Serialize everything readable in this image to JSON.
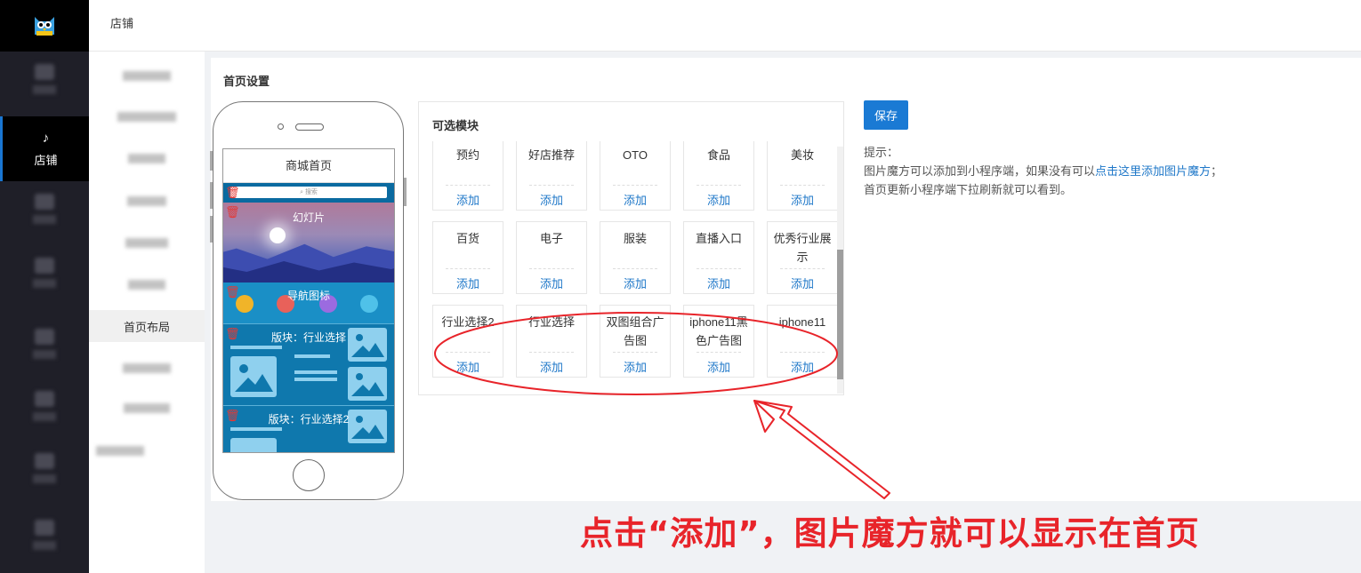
{
  "topbar": {
    "title": "店铺"
  },
  "rail": {
    "active_label": "店铺"
  },
  "submenu": {
    "active_label": "首页布局"
  },
  "page": {
    "title": "首页设置"
  },
  "phone": {
    "screen_title": "商城首页",
    "search_placeholder": "搜索",
    "slide_label": "幻灯片",
    "nav_label": "导航图标",
    "block1_label": "版块：行业选择",
    "block2_label": "版块：行业选择2"
  },
  "modules": {
    "title": "可选模块",
    "add_label": "添加",
    "items": [
      {
        "name": "预约"
      },
      {
        "name": "好店推荐"
      },
      {
        "name": "OTO"
      },
      {
        "name": "食品"
      },
      {
        "name": "美妆"
      },
      {
        "name": "百货"
      },
      {
        "name": "电子"
      },
      {
        "name": "服装"
      },
      {
        "name": "直播入口"
      },
      {
        "name": "优秀行业展示"
      },
      {
        "name": "行业选择2"
      },
      {
        "name": "行业选择"
      },
      {
        "name": "双图组合广告图"
      },
      {
        "name": "iphone11黑色广告图"
      },
      {
        "name": "iphone11"
      }
    ]
  },
  "actions": {
    "save_label": "保存"
  },
  "tips": {
    "heading": "提示：",
    "line1_prefix": "图片魔方可以添加到小程序端，如果没有可以",
    "line1_link": "点击这里添加图片魔方",
    "line1_suffix": "；",
    "line2": "首页更新小程序端下拉刷新就可以看到。"
  },
  "annotation": {
    "text": "点击“添加”，图片魔方就可以显示在首页"
  },
  "colors": {
    "accent": "#1a7ad4",
    "annotation": "#e8242a",
    "rail": "#1f1f28"
  }
}
